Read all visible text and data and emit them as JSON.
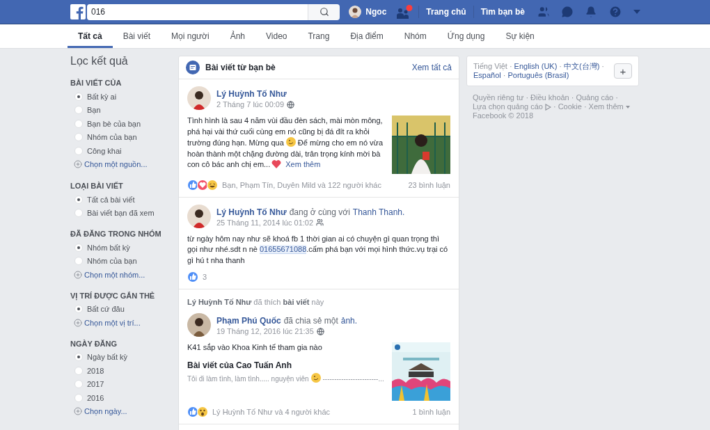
{
  "header": {
    "search_value": "016",
    "user_name": "Ngoc",
    "friend_requests_new": true,
    "nav": [
      "Trang chủ",
      "Tìm bạn bè"
    ]
  },
  "tabs": [
    {
      "label": "Tất cả",
      "selected": true
    },
    {
      "label": "Bài viết",
      "selected": false
    },
    {
      "label": "Mọi người",
      "selected": false
    },
    {
      "label": "Ảnh",
      "selected": false
    },
    {
      "label": "Video",
      "selected": false
    },
    {
      "label": "Trang",
      "selected": false
    },
    {
      "label": "Địa điểm",
      "selected": false
    },
    {
      "label": "Nhóm",
      "selected": false
    },
    {
      "label": "Ứng dụng",
      "selected": false
    },
    {
      "label": "Sự kiện",
      "selected": false
    }
  ],
  "filters": {
    "title": "Lọc kết quả",
    "sections": [
      {
        "heading": "BÀI VIẾT CỦA",
        "options": [
          {
            "label": "Bất kỳ ai",
            "selected": true
          },
          {
            "label": "Bạn",
            "selected": false
          },
          {
            "label": "Bạn bè của bạn",
            "selected": false
          },
          {
            "label": "Nhóm của bạn",
            "selected": false
          },
          {
            "label": "Công khai",
            "selected": false
          }
        ],
        "more": "Chọn một nguồn..."
      },
      {
        "heading": "LOẠI BÀI VIẾT",
        "options": [
          {
            "label": "Tất cả bài viết",
            "selected": true
          },
          {
            "label": "Bài viết bạn đã xem",
            "selected": false
          }
        ]
      },
      {
        "heading": "ĐÃ ĐĂNG TRONG NHÓM",
        "options": [
          {
            "label": "Nhóm bất kỳ",
            "selected": true
          },
          {
            "label": "Nhóm của bạn",
            "selected": false
          }
        ],
        "more": "Chọn một nhóm..."
      },
      {
        "heading": "VỊ TRÍ ĐƯỢC GẮN THẺ",
        "options": [
          {
            "label": "Bất cứ đâu",
            "selected": true
          }
        ],
        "more": "Chọn một vị trí..."
      },
      {
        "heading": "NGÀY ĐĂNG",
        "options": [
          {
            "label": "Ngày bất kỳ",
            "selected": true
          },
          {
            "label": "2018",
            "selected": false
          },
          {
            "label": "2017",
            "selected": false
          },
          {
            "label": "2016",
            "selected": false
          }
        ],
        "more": "Chọn ngày..."
      }
    ]
  },
  "feed": {
    "title": "Bài viết từ bạn bè",
    "see_all": "Xem tất cả",
    "posts": [
      {
        "author": "Lý Huỳnh Tố Như",
        "time": "2 Tháng 7 lúc 00:09",
        "audience": {
          "kind": "public"
        },
        "segments": [
          {
            "kind": "text",
            "text": "Tình hình là sau 4 năm vùi đầu đèn sách, mài mòn mông, phá hại vài thứ cuối cùng em nó cũng bị đá đít ra khỏi trường đúng hạn. Mừng qua"
          },
          {
            "kind": "smiley"
          },
          {
            "kind": "text",
            "text": "Để mừng cho em nó vừa hoàn thành một chặng đường dài, trân trọng kính mời bà con cô bác anh chị em..."
          },
          {
            "kind": "heart"
          },
          {
            "kind": "link",
            "text": "Xem thêm"
          }
        ],
        "photo": {
          "kind": "picture"
        },
        "reactions": [
          {
            "kind": "like"
          },
          {
            "kind": "love"
          },
          {
            "kind": "haha"
          }
        ],
        "reactions_text": "Bạn, Phạm Tín, Duyên Mild và 122 người khác",
        "comments": "23 bình luận"
      },
      {
        "author": "Lý Huỳnh Tố Như",
        "action": "đang ở cùng với",
        "target": "Thanh Thanh.",
        "time": "25 Tháng 11, 2014 lúc 01:02",
        "audience": {
          "kind": "friends"
        },
        "segments": [
          {
            "kind": "text",
            "text": "từ ngày hôm nay như sẽ khoá fb 1 thời gian ai có chuyện gì quan trọng thì gọi như nhé.sdt n nè "
          },
          {
            "kind": "phone",
            "text": "01655671088"
          },
          {
            "kind": "text",
            "text": ".cấm phá bạn với mọi hình thức.vụ trại có gì hú t nha thanh"
          }
        ],
        "reactions": [
          {
            "kind": "like"
          }
        ],
        "reactions_text": "3"
      },
      {
        "context": "**Lý Huỳnh Tố Như** đã thích **bài viết** này",
        "author": "Phạm Phú Quốc",
        "action": "đã chia sẻ một",
        "target": "ảnh.",
        "time": "19 Tháng 12, 2016 lúc 21:35",
        "audience": {
          "kind": "public"
        },
        "segments": [
          {
            "kind": "text",
            "text": "K41 sắp vào Khoa Kinh tế tham gia nào"
          }
        ],
        "shared": {
          "title": "Bài viết của Cao Tuấn Anh",
          "segments": [
            {
              "kind": "text",
              "text": "Tôi đi làm tình, làm tình..... nguyện viên"
            },
            {
              "kind": "smiley"
            },
            {
              "kind": "text",
              "text": "------------------------..."
            }
          ]
        },
        "photo": {
          "kind": "picture"
        },
        "reactions": [
          {
            "kind": "like"
          },
          {
            "kind": "wow"
          }
        ],
        "reactions_text": "Lý Huỳnh Tố Như và 4 người khác",
        "comments": "1 bình luận"
      }
    ]
  },
  "languages": {
    "items": [
      {
        "label": "Tiếng Việt",
        "selected": true
      },
      {
        "label": "English (UK)",
        "selected": false
      },
      {
        "label": "中文(台灣)",
        "selected": false
      },
      {
        "label": "Español",
        "selected": false
      },
      {
        "label": "Português (Brasil)",
        "selected": false
      }
    ],
    "add": "+"
  },
  "footer": {
    "separator": "·",
    "links": [
      {
        "label": "Quyền riêng tư"
      },
      {
        "label": "Điều khoản"
      },
      {
        "label": "Quảng cáo"
      },
      {
        "label": "Lựa chọn quảng cáo",
        "kind": "adchoices"
      },
      {
        "label": "Cookie"
      },
      {
        "label": "Xem thêm",
        "kind": "menu"
      }
    ],
    "copyright": "Facebook © 2018"
  }
}
